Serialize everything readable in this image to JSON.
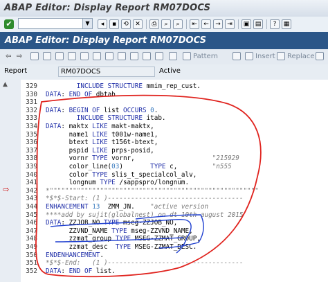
{
  "window": {
    "title": "ABAP Editor: Display Report RM07DOCS"
  },
  "toolbar": {
    "command_value": ""
  },
  "app": {
    "title": "ABAP Editor: Display Report RM07DOCS"
  },
  "app_buttons": {
    "pattern": "Pattern",
    "insert": "Insert",
    "replace": "Replace"
  },
  "header": {
    "report_label": "Report",
    "report_value": "RM07DOCS",
    "status": "Active"
  },
  "editor": {
    "lines": [
      {
        "num": "329",
        "code": "        INCLUDE STRUCTURE mmim_rep_cust."
      },
      {
        "num": "330",
        "code": "DATA: END OF dbtab."
      },
      {
        "num": "331",
        "code": ""
      },
      {
        "num": "332",
        "code": "DATA: BEGIN OF list OCCURS 0."
      },
      {
        "num": "333",
        "code": "        INCLUDE STRUCTURE itab."
      },
      {
        "num": "334",
        "code": "DATA: maktx LIKE makt-maktx,"
      },
      {
        "num": "335",
        "code": "      name1 LIKE t001w-name1,"
      },
      {
        "num": "336",
        "code": "      btext LIKE t156t-btext,"
      },
      {
        "num": "337",
        "code": "      pspid LIKE prps-posid,"
      },
      {
        "num": "338",
        "code": "      vornr TYPE vornr,                    \"215929"
      },
      {
        "num": "339",
        "code": "      color_line(03)       TYPE c,         \"n555"
      },
      {
        "num": "340",
        "code": "      color TYPE slis_t_specialcol_alv,"
      },
      {
        "num": "341",
        "code": "      longnum TYPE /sappspro/longnum."
      },
      {
        "num": "342",
        "code": "*\"\"\"\"\"\"\"\"\"\"\"\"\"\"\"\"\"\"\"\"\"\"\"\"\"\"\"\"\"\"\"\"\"\"\"\"\"\"\"\"\"\"\"\"\"\"\"\"\"\"\"\"\"\""
      },
      {
        "num": "343",
        "code": "*$*$-Start: (1 )-----------------------------------"
      },
      {
        "num": "344",
        "code": "ENHANCEMENT 13  ZMM_JN.    \"active version"
      },
      {
        "num": "345",
        "code": "****add by sujit(globalnest) on dt 10th august 2015"
      },
      {
        "num": "346",
        "code": "DATA: ZZJOB_NO TYPE mseg-ZZJOB_NO,"
      },
      {
        "num": "347",
        "code": "      ZZVND_NAME TYPE mseg-ZZVND_NAME,"
      },
      {
        "num": "348",
        "code": "      zzmat_group TYPE MSEG-ZZMAT_GROUP,"
      },
      {
        "num": "349",
        "code": "      zzmat_desc  TYPE MSEG-ZZMAT_DESC."
      },
      {
        "num": "350",
        "code": "ENDENHANCEMENT."
      },
      {
        "num": "351",
        "code": "*$*$-End:   (1 )-----------------------------------"
      },
      {
        "num": "352",
        "code": "DATA: END OF list."
      }
    ]
  },
  "colors": {
    "app_bar": "#2b5688",
    "keyword": "#1f2ea8",
    "comment": "#7a7a7a",
    "annotation_red": "#e0231e",
    "annotation_blue": "#1e3fd0"
  }
}
